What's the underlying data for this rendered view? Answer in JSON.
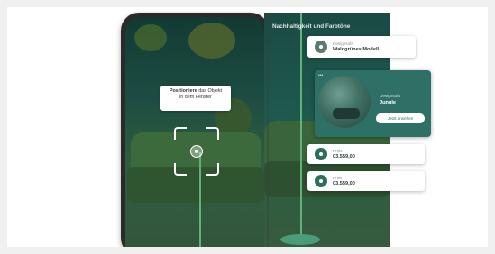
{
  "section_title": "Nachhaltigkeit und Farbtöne",
  "instruction": {
    "line1_bold": "Positioniere",
    "line1_rest": "das Objekt",
    "line2": "in dem Fenster"
  },
  "cards": [
    {
      "small": "Designsofa",
      "big": "Waldgrünes Modell"
    },
    {
      "small": "Preis",
      "big": "03.559,00"
    },
    {
      "small": "Preis",
      "big": "03.559,00"
    }
  ],
  "feature": {
    "small": "Designsofa",
    "big": "Jungle",
    "cta": "Jetzt ansehen",
    "menu": "•••"
  },
  "colors": {
    "accent": "#2f7066",
    "pole": "#5fb37a",
    "room": "#1f5a4f"
  }
}
